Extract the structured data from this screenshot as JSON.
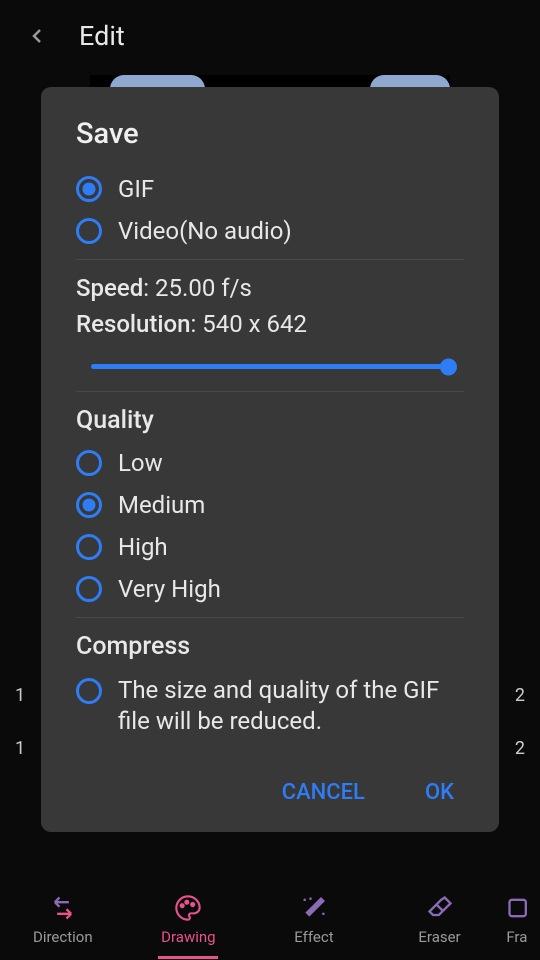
{
  "header": {
    "title": "Edit"
  },
  "dialog": {
    "title": "Save",
    "format_options": [
      {
        "label": "GIF",
        "selected": true
      },
      {
        "label": "Video(No audio)",
        "selected": false
      }
    ],
    "speed": {
      "label": "Speed",
      "value": "25.00 f/s"
    },
    "resolution": {
      "label": "Resolution",
      "value": "540 x 642"
    },
    "quality": {
      "title": "Quality",
      "options": [
        {
          "label": "Low",
          "selected": false
        },
        {
          "label": "Medium",
          "selected": true
        },
        {
          "label": "High",
          "selected": false
        },
        {
          "label": "Very High",
          "selected": false
        }
      ]
    },
    "compress": {
      "title": "Compress",
      "description": "The size and quality of the GIF file will be reduced.",
      "selected": false
    },
    "actions": {
      "cancel": "CANCEL",
      "ok": "OK"
    }
  },
  "side_numbers": {
    "left_top": "1",
    "left_bottom": "1",
    "right_top": "2",
    "right_bottom": "2"
  },
  "bottom_nav": {
    "items": [
      {
        "label": "Direction",
        "active": false
      },
      {
        "label": "Drawing",
        "active": true
      },
      {
        "label": "Effect",
        "active": false
      },
      {
        "label": "Eraser",
        "active": false
      },
      {
        "label": "Fra",
        "active": false
      }
    ]
  }
}
